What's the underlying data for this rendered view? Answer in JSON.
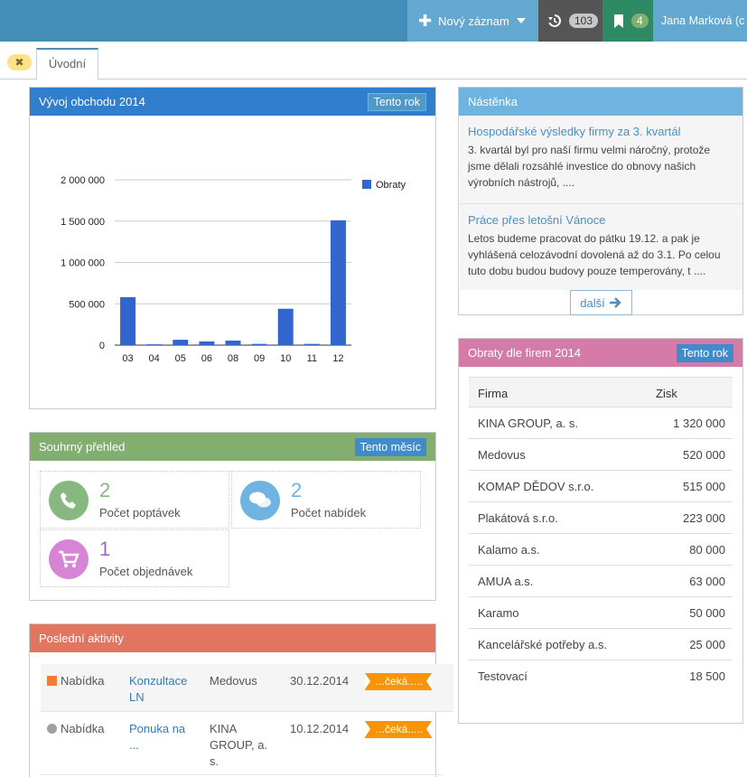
{
  "topbar": {
    "new_record": "Nový záznam",
    "history_count": "103",
    "bookmarks_count": "4",
    "user_name": "Jana Marková (c"
  },
  "tabs": [
    {
      "label": "Úvodní"
    }
  ],
  "tab_close_icon": "✖",
  "business": {
    "title": "Vývoj obchodu 2014",
    "button": "Tento rok"
  },
  "chart_data": {
    "type": "bar",
    "title": "",
    "categories": [
      "03",
      "04",
      "05",
      "06",
      "08",
      "09",
      "10",
      "11",
      "12"
    ],
    "series": [
      {
        "name": "Obraty",
        "values": [
          580000,
          10000,
          65000,
          45000,
          55000,
          15000,
          440000,
          15000,
          1510000
        ]
      }
    ],
    "ylim": [
      0,
      2000000
    ],
    "yticks": [
      0,
      500000,
      1000000,
      1500000,
      2000000
    ],
    "ytick_labels": [
      "0",
      "500 000",
      "1 000 000",
      "1 500 000",
      "2 000 000"
    ],
    "grid": true,
    "legend": "top-right",
    "color": "#3366cc"
  },
  "summary": {
    "title": "Souhrný přehled",
    "button": "Tento měsíc",
    "items": [
      {
        "value": "2",
        "label": "Počet poptávek",
        "color": "#87b87f"
      },
      {
        "value": "2",
        "label": "Počet nabídek",
        "color": "#6fb3e0"
      },
      {
        "value": "1",
        "label": "Počet objednávek",
        "color": "#a069c3"
      }
    ]
  },
  "activities": {
    "title": "Poslední aktivity",
    "rows": [
      {
        "type": "Nabídka",
        "subject": "Konzultace LN",
        "firm": "Medovus",
        "date": "30.12.2014",
        "status": "...čeká....."
      },
      {
        "type": "Nabídka",
        "subject": "Ponuka na ...",
        "firm": "KINA GROUP, a. s.",
        "date": "10.12.2014",
        "status": "...čeká....."
      }
    ]
  },
  "board": {
    "title": "Nástěnka",
    "posts": [
      {
        "title": "Hospodářské výsledky firmy za 3. kvartál",
        "text": "3. kvartál byl pro naší firmu velmi náročný, protože jsme dělali rozsáhlé investice do obnovy našich výrobních nástrojů, ...."
      },
      {
        "title": "Práce přes letošní Vánoce",
        "text": "Letos budeme pracovat do pátku 19.12. a pak je vyhlášená celozávodní dovolená až do 3.1. Po celou tuto dobu budou budovy pouze temperovány, t ...."
      }
    ],
    "more": "další"
  },
  "firms": {
    "title": "Obraty dle firem 2014",
    "button": "Tento rok",
    "columns": [
      "Firma",
      "Zisk"
    ],
    "rows": [
      {
        "name": "KINA GROUP, a. s.",
        "value": "1 320 000"
      },
      {
        "name": "Medovus",
        "value": "520 000"
      },
      {
        "name": "KOMAP DĚDOV s.r.o.",
        "value": "515 000"
      },
      {
        "name": "Plakátová s.r.o.",
        "value": "223 000"
      },
      {
        "name": "Kalamo a.s.",
        "value": "80 000"
      },
      {
        "name": "AMUA a.s.",
        "value": "63 000"
      },
      {
        "name": "Karamo",
        "value": "50 000"
      },
      {
        "name": "Kancelářské potřeby a.s.",
        "value": "25 000"
      },
      {
        "name": "Testovací",
        "value": "18 500"
      }
    ]
  }
}
